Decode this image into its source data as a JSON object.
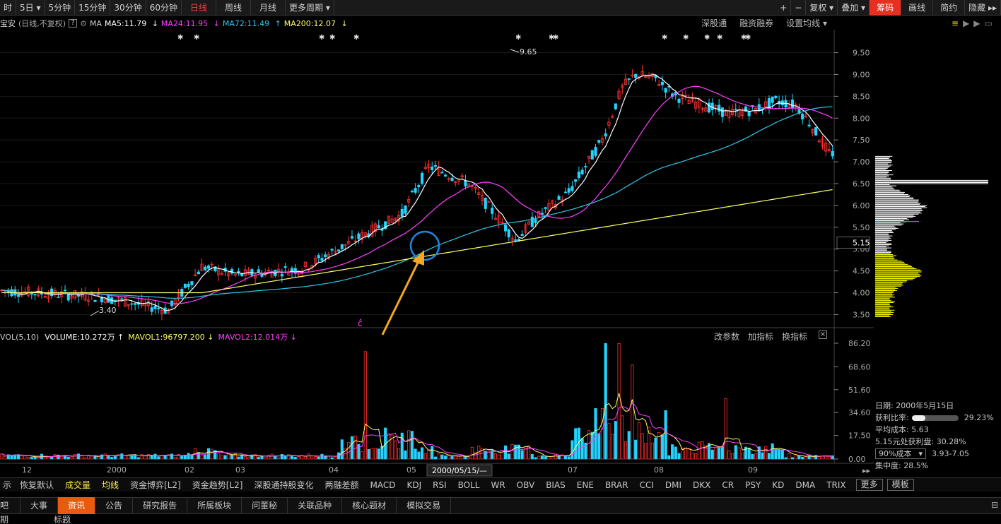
{
  "toolbar": {
    "tabs": [
      "时",
      "5日",
      "5分钟",
      "15分钟",
      "30分钟",
      "60分钟",
      "日线",
      "周线",
      "月线",
      "更多周期"
    ],
    "active": "日线",
    "right": [
      "+",
      "−",
      "复权",
      "叠加",
      "筹码",
      "画线",
      "简约",
      "隐藏"
    ]
  },
  "ma_bar": {
    "stock": "宝安",
    "mode": "(日线,不复权)",
    "q": "?",
    "gear": "gear-icon",
    "ma": "MA",
    "ma5": "MA5:11.79",
    "ma24": "MA24:11.95",
    "ma72": "MA72:11.49",
    "ma200": "MA200:12.07",
    "links": [
      "深股通",
      "融资融券",
      "设置均线"
    ]
  },
  "colors": {
    "up": "#ff3232",
    "down": "#22d4ff",
    "ma5": "#ffffff",
    "ma24": "#ff40ff",
    "ma72": "#2fc8e8",
    "ma200": "#ffff66",
    "grid": "#333333",
    "accent": "#e85a10"
  },
  "price_axis": {
    "ticks": [
      "9.50",
      "9.00",
      "8.50",
      "8.00",
      "7.50",
      "7.00",
      "6.50",
      "6.00",
      "5.50",
      "5.00",
      "4.50",
      "4.00",
      "3.50"
    ],
    "current": "5.15"
  },
  "annotations": {
    "high": "9.65",
    "low": "3.40",
    "arrow_label": "ĉ"
  },
  "x_axis": {
    "labels": [
      "12",
      "2000",
      "02",
      "03",
      "04",
      "05",
      "07",
      "08",
      "09"
    ],
    "cursor": "2000/05/15/—"
  },
  "volume": {
    "label": "VOL(5,10)",
    "volume": "VOLUME:10.272万",
    "mavol1": "MAVOL1:96797.200",
    "mavol2": "MAVOL2:12.014万",
    "links": [
      "改参数",
      "加指标",
      "换指标"
    ],
    "ticks": [
      "86.20",
      "68.60",
      "51.60",
      "34.60",
      "17.50",
      "0.00"
    ]
  },
  "cost": {
    "date": "日期: 2000年5月15日",
    "profit_label": "获利比率:",
    "profit_value": "29.23%",
    "avg": "平均成本: 5.63",
    "profit_at": "5.15元处获利盘: 30.28%",
    "select": "90%成本",
    "range": "3.93-7.05",
    "concentration": "集中度: 28.5%"
  },
  "indicators": [
    "示",
    "恢复默认",
    "成交量",
    "均线",
    "资金博弈[L2]",
    "资金趋势[L2]",
    "深股通持股变化",
    "两融差额",
    "MACD",
    "KDJ",
    "RSI",
    "BOLL",
    "WR",
    "OBV",
    "BIAS",
    "ENE",
    "BRAR",
    "CCI",
    "DMI",
    "DKX",
    "CR",
    "PSY",
    "KD",
    "DMA",
    "TRIX",
    "更多",
    "模板"
  ],
  "bottom_tabs": [
    "吧",
    "大事",
    "资讯",
    "公告",
    "研究报告",
    "所属板块",
    "问董秘",
    "关联品种",
    "核心题材",
    "模拟交易"
  ],
  "bottom_active": "资讯",
  "bottom_row": [
    "期",
    "标题"
  ]
}
